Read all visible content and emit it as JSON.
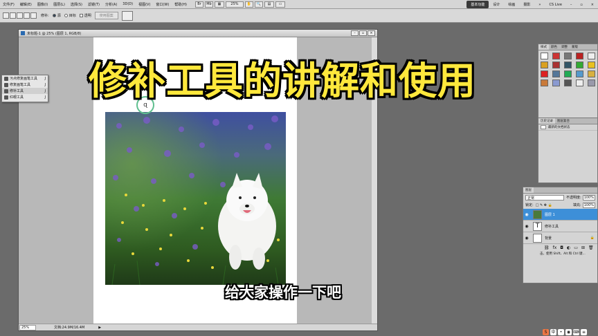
{
  "menubar": {
    "items": [
      "文件(F)",
      "编辑(E)",
      "图像(I)",
      "图层(L)",
      "选择(S)",
      "滤镜(T)",
      "分析(A)",
      "3D(D)",
      "视图(V)",
      "窗口(W)",
      "帮助(H)"
    ],
    "zoom": "25%",
    "workspaces": [
      "基本功能",
      "设计",
      "绘画",
      "摄影"
    ],
    "cs_live": "CS Live"
  },
  "options": {
    "patch_label": "修补:",
    "source": "源",
    "target": "目标",
    "transparent": "透明",
    "use_pattern": "使用图案"
  },
  "document": {
    "title": "未标题-1 @ 25% (图层 1, RGB/8)",
    "status_zoom": "25%",
    "status_doc": "文档:24.9M/16.4M"
  },
  "tool_flyout": [
    {
      "label": "污点修复画笔工具",
      "key": "J"
    },
    {
      "label": "修复画笔工具",
      "key": "J"
    },
    {
      "label": "修补工具",
      "key": "J"
    },
    {
      "label": "红眼工具",
      "key": "J"
    }
  ],
  "panels": {
    "swatch_tabs": [
      "样式",
      "颜色",
      "调整",
      "蒙版"
    ],
    "history_tabs": [
      "历史记录",
      "图层复合"
    ],
    "history_item": "最新的文档状态",
    "layers_tab": "图层",
    "blend_mode": "正常",
    "opacity_label": "不透明度:",
    "opacity_value": "100%",
    "lock_label": "锁定:",
    "fill_label": "填充:",
    "fill_value": "100%",
    "layers": [
      {
        "name": "图层 1",
        "selected": true
      },
      {
        "name": "修补工具",
        "selected": false
      },
      {
        "name": "背景",
        "selected": false
      }
    ],
    "tip": "击，使用 Shift、Alt 和 Ctrl 键..."
  },
  "overlay": {
    "title": "修补工具的讲解和使用",
    "subtitle": "给大家操作一下吧"
  },
  "colors": {
    "title_yellow": "#ffe83c",
    "selection_blue": "#3d8fd8",
    "canvas_gray": "#b8b8b8"
  }
}
